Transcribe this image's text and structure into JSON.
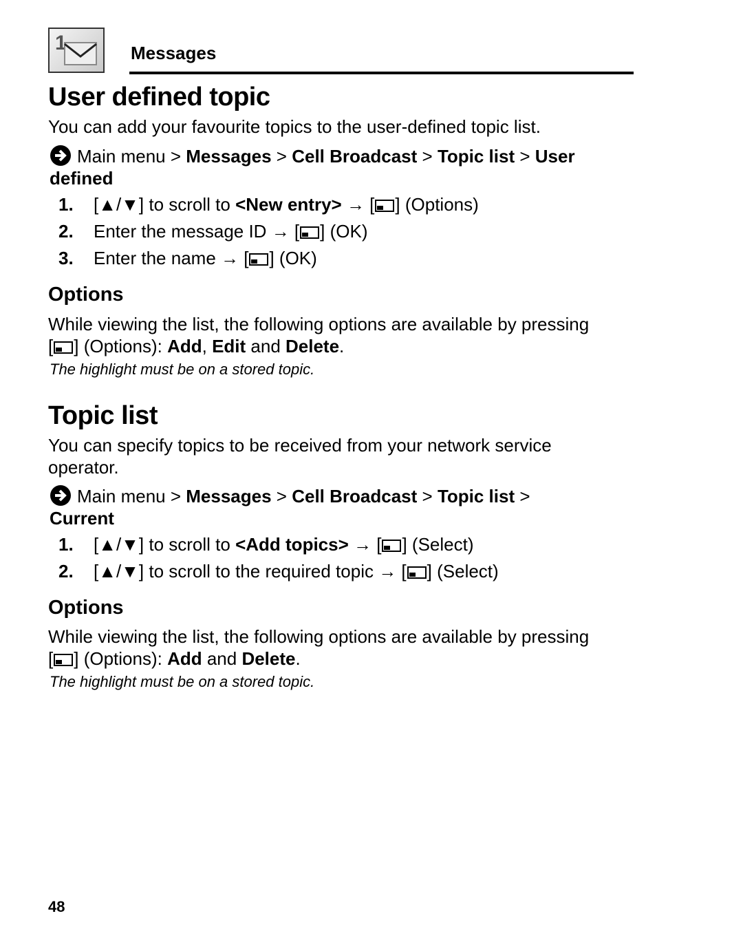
{
  "header": {
    "section": "Messages",
    "icon": "messages-envelope-icon"
  },
  "s1": {
    "title": "User defined topic",
    "intro": "You can add your favourite topics to the user-defined topic list.",
    "nav": {
      "prefix": "Main menu",
      "sep": " > ",
      "path": [
        "Messages",
        "Cell Broadcast",
        "Topic list",
        "User defined"
      ]
    },
    "steps": [
      {
        "num": "1.",
        "pre": "[▲/▼] to scroll to ",
        "bold": "<New entry>",
        "post": " (Options)"
      },
      {
        "num": "2.",
        "pre": "Enter the message ID",
        "post": " (OK)"
      },
      {
        "num": "3.",
        "pre": "Enter the name",
        "post": " (OK)"
      }
    ],
    "options": {
      "title": "Options",
      "text": "While viewing the list, the following options are available by pressing",
      "line2_pre": "(Options): ",
      "items": [
        "Add",
        "Edit",
        "Delete"
      ],
      "note": "The highlight must be on a stored topic."
    }
  },
  "s2": {
    "title": "Topic list",
    "intro": "You can specify topics to be received from your network service operator.",
    "nav": {
      "prefix": "Main menu",
      "path": [
        "Messages",
        "Cell Broadcast",
        "Topic list",
        "Current"
      ]
    },
    "steps": [
      {
        "num": "1.",
        "pre": "[▲/▼] to scroll to ",
        "bold": "<Add topics>",
        "post": " (Select)"
      },
      {
        "num": "2.",
        "pre": "[▲/▼] to scroll to the required topic",
        "post": " (Select)"
      }
    ],
    "options": {
      "title": "Options",
      "text": "While viewing the list, the following options are available by pressing",
      "line2_pre": "(Options): ",
      "items": [
        "Add",
        "Delete"
      ],
      "note": "The highlight must be on a stored topic."
    }
  },
  "footer": {
    "page": "48"
  }
}
